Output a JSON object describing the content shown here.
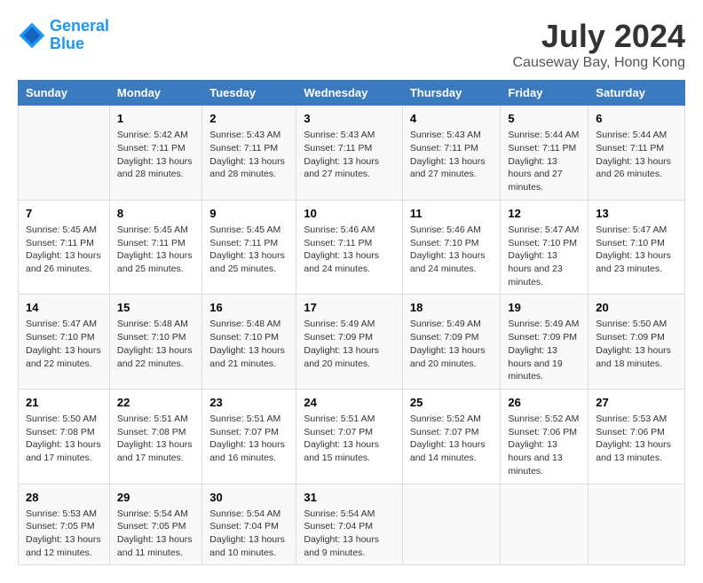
{
  "logo": {
    "line1": "General",
    "line2": "Blue"
  },
  "title": "July 2024",
  "subtitle": "Causeway Bay, Hong Kong",
  "columns": [
    "Sunday",
    "Monday",
    "Tuesday",
    "Wednesday",
    "Thursday",
    "Friday",
    "Saturday"
  ],
  "weeks": [
    [
      {
        "day": "",
        "sunrise": "",
        "sunset": "",
        "daylight": ""
      },
      {
        "day": "1",
        "sunrise": "Sunrise: 5:42 AM",
        "sunset": "Sunset: 7:11 PM",
        "daylight": "Daylight: 13 hours and 28 minutes."
      },
      {
        "day": "2",
        "sunrise": "Sunrise: 5:43 AM",
        "sunset": "Sunset: 7:11 PM",
        "daylight": "Daylight: 13 hours and 28 minutes."
      },
      {
        "day": "3",
        "sunrise": "Sunrise: 5:43 AM",
        "sunset": "Sunset: 7:11 PM",
        "daylight": "Daylight: 13 hours and 27 minutes."
      },
      {
        "day": "4",
        "sunrise": "Sunrise: 5:43 AM",
        "sunset": "Sunset: 7:11 PM",
        "daylight": "Daylight: 13 hours and 27 minutes."
      },
      {
        "day": "5",
        "sunrise": "Sunrise: 5:44 AM",
        "sunset": "Sunset: 7:11 PM",
        "daylight": "Daylight: 13 hours and 27 minutes."
      },
      {
        "day": "6",
        "sunrise": "Sunrise: 5:44 AM",
        "sunset": "Sunset: 7:11 PM",
        "daylight": "Daylight: 13 hours and 26 minutes."
      }
    ],
    [
      {
        "day": "7",
        "sunrise": "Sunrise: 5:45 AM",
        "sunset": "Sunset: 7:11 PM",
        "daylight": "Daylight: 13 hours and 26 minutes."
      },
      {
        "day": "8",
        "sunrise": "Sunrise: 5:45 AM",
        "sunset": "Sunset: 7:11 PM",
        "daylight": "Daylight: 13 hours and 25 minutes."
      },
      {
        "day": "9",
        "sunrise": "Sunrise: 5:45 AM",
        "sunset": "Sunset: 7:11 PM",
        "daylight": "Daylight: 13 hours and 25 minutes."
      },
      {
        "day": "10",
        "sunrise": "Sunrise: 5:46 AM",
        "sunset": "Sunset: 7:11 PM",
        "daylight": "Daylight: 13 hours and 24 minutes."
      },
      {
        "day": "11",
        "sunrise": "Sunrise: 5:46 AM",
        "sunset": "Sunset: 7:10 PM",
        "daylight": "Daylight: 13 hours and 24 minutes."
      },
      {
        "day": "12",
        "sunrise": "Sunrise: 5:47 AM",
        "sunset": "Sunset: 7:10 PM",
        "daylight": "Daylight: 13 hours and 23 minutes."
      },
      {
        "day": "13",
        "sunrise": "Sunrise: 5:47 AM",
        "sunset": "Sunset: 7:10 PM",
        "daylight": "Daylight: 13 hours and 23 minutes."
      }
    ],
    [
      {
        "day": "14",
        "sunrise": "Sunrise: 5:47 AM",
        "sunset": "Sunset: 7:10 PM",
        "daylight": "Daylight: 13 hours and 22 minutes."
      },
      {
        "day": "15",
        "sunrise": "Sunrise: 5:48 AM",
        "sunset": "Sunset: 7:10 PM",
        "daylight": "Daylight: 13 hours and 22 minutes."
      },
      {
        "day": "16",
        "sunrise": "Sunrise: 5:48 AM",
        "sunset": "Sunset: 7:10 PM",
        "daylight": "Daylight: 13 hours and 21 minutes."
      },
      {
        "day": "17",
        "sunrise": "Sunrise: 5:49 AM",
        "sunset": "Sunset: 7:09 PM",
        "daylight": "Daylight: 13 hours and 20 minutes."
      },
      {
        "day": "18",
        "sunrise": "Sunrise: 5:49 AM",
        "sunset": "Sunset: 7:09 PM",
        "daylight": "Daylight: 13 hours and 20 minutes."
      },
      {
        "day": "19",
        "sunrise": "Sunrise: 5:49 AM",
        "sunset": "Sunset: 7:09 PM",
        "daylight": "Daylight: 13 hours and 19 minutes."
      },
      {
        "day": "20",
        "sunrise": "Sunrise: 5:50 AM",
        "sunset": "Sunset: 7:09 PM",
        "daylight": "Daylight: 13 hours and 18 minutes."
      }
    ],
    [
      {
        "day": "21",
        "sunrise": "Sunrise: 5:50 AM",
        "sunset": "Sunset: 7:08 PM",
        "daylight": "Daylight: 13 hours and 17 minutes."
      },
      {
        "day": "22",
        "sunrise": "Sunrise: 5:51 AM",
        "sunset": "Sunset: 7:08 PM",
        "daylight": "Daylight: 13 hours and 17 minutes."
      },
      {
        "day": "23",
        "sunrise": "Sunrise: 5:51 AM",
        "sunset": "Sunset: 7:07 PM",
        "daylight": "Daylight: 13 hours and 16 minutes."
      },
      {
        "day": "24",
        "sunrise": "Sunrise: 5:51 AM",
        "sunset": "Sunset: 7:07 PM",
        "daylight": "Daylight: 13 hours and 15 minutes."
      },
      {
        "day": "25",
        "sunrise": "Sunrise: 5:52 AM",
        "sunset": "Sunset: 7:07 PM",
        "daylight": "Daylight: 13 hours and 14 minutes."
      },
      {
        "day": "26",
        "sunrise": "Sunrise: 5:52 AM",
        "sunset": "Sunset: 7:06 PM",
        "daylight": "Daylight: 13 hours and 13 minutes."
      },
      {
        "day": "27",
        "sunrise": "Sunrise: 5:53 AM",
        "sunset": "Sunset: 7:06 PM",
        "daylight": "Daylight: 13 hours and 13 minutes."
      }
    ],
    [
      {
        "day": "28",
        "sunrise": "Sunrise: 5:53 AM",
        "sunset": "Sunset: 7:05 PM",
        "daylight": "Daylight: 13 hours and 12 minutes."
      },
      {
        "day": "29",
        "sunrise": "Sunrise: 5:54 AM",
        "sunset": "Sunset: 7:05 PM",
        "daylight": "Daylight: 13 hours and 11 minutes."
      },
      {
        "day": "30",
        "sunrise": "Sunrise: 5:54 AM",
        "sunset": "Sunset: 7:04 PM",
        "daylight": "Daylight: 13 hours and 10 minutes."
      },
      {
        "day": "31",
        "sunrise": "Sunrise: 5:54 AM",
        "sunset": "Sunset: 7:04 PM",
        "daylight": "Daylight: 13 hours and 9 minutes."
      },
      {
        "day": "",
        "sunrise": "",
        "sunset": "",
        "daylight": ""
      },
      {
        "day": "",
        "sunrise": "",
        "sunset": "",
        "daylight": ""
      },
      {
        "day": "",
        "sunrise": "",
        "sunset": "",
        "daylight": ""
      }
    ]
  ]
}
